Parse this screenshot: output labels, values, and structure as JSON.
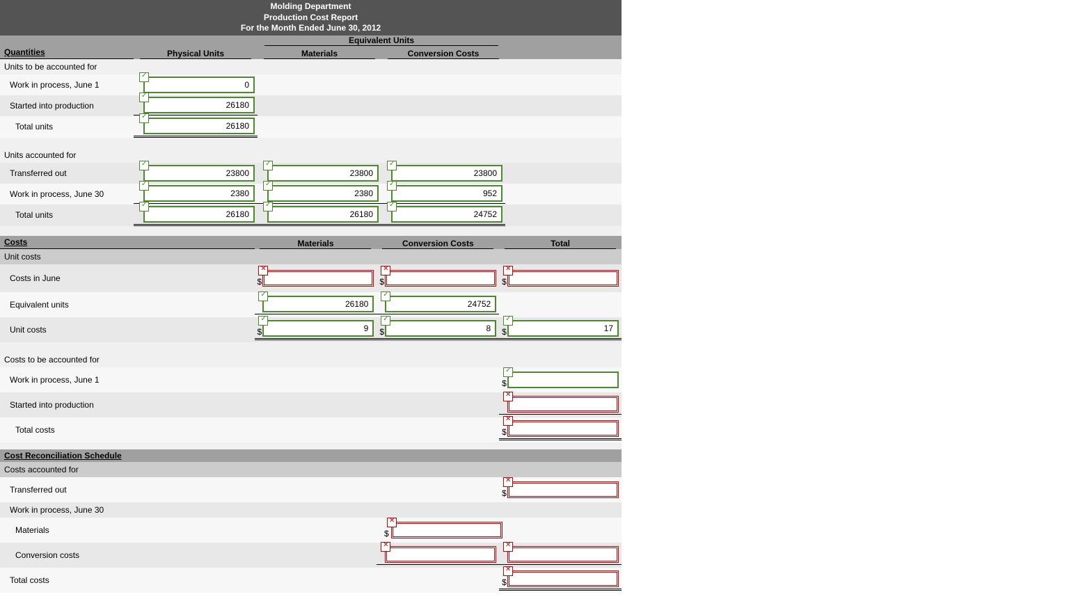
{
  "title": {
    "l2": "Molding Department",
    "l3": "Production Cost Report",
    "l4": "For the Month Ended June 30, 2012"
  },
  "headers": {
    "quantities": "Quantities",
    "physical": "Physical Units",
    "equivalent": "Equivalent Units",
    "materials": "Materials",
    "conversion": "Conversion Costs",
    "costs": "Costs",
    "total": "Total",
    "crs": "Cost Reconciliation Schedule"
  },
  "labels": {
    "units_tba": "Units to be accounted for",
    "wip_jun1": "Work in process, June 1",
    "started": "Started into production",
    "total_units": "Total units",
    "units_af": "Units accounted for",
    "transferred": "Transferred out",
    "wip_jun30": "Work in process, June 30",
    "unit_costs_sec": "Unit costs",
    "costs_june": "Costs in June",
    "eq_units": "Equivalent units",
    "unit_costs": "Unit costs",
    "costs_tba": "Costs to be accounted for",
    "total_costs": "Total costs",
    "costs_af": "Costs accounted for",
    "materials": "Materials",
    "conv_costs": "Conversion costs"
  },
  "values": {
    "wip_jun1_phys": "0",
    "started_phys": "26180",
    "total_units_phys": "26180",
    "trans_phys": "23800",
    "trans_mat": "23800",
    "trans_conv": "23800",
    "wip30_phys": "2380",
    "wip30_mat": "2380",
    "wip30_conv": "952",
    "total2_phys": "26180",
    "total2_mat": "26180",
    "total2_conv": "24752",
    "costs_june_mat": "",
    "costs_june_conv": "",
    "costs_june_total": "",
    "eq_mat": "26180",
    "eq_conv": "24752",
    "uc_mat": "9",
    "uc_conv": "8",
    "uc_total": "17",
    "wip1_total": "",
    "started_total": "",
    "tc_total": "",
    "trans_total": "",
    "wip30_mat2": "",
    "wip30_conv2": "",
    "wip30_total2": "",
    "tc2_total": ""
  }
}
